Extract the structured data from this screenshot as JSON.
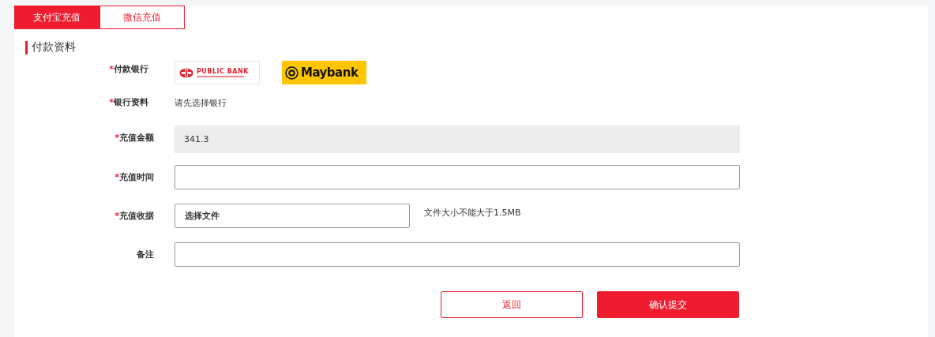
{
  "tabs": [
    {
      "label": "支付宝充值",
      "selected": true
    },
    {
      "label": "微信充值",
      "selected": false
    }
  ],
  "section_title": "付款资料",
  "fields": [
    {
      "kind": "banks",
      "required_mark": "*",
      "label": "付款银行",
      "banks": [
        {
          "kind": "public",
          "name": "PUBLIC BANK"
        },
        {
          "kind": "maybank",
          "name": "Maybank"
        }
      ]
    },
    {
      "kind": "text",
      "required_mark": "*",
      "label": "银行资料",
      "value": "请先选择银行"
    },
    {
      "kind": "readonly",
      "required_mark": "*",
      "label": "充值金额",
      "value": "341.3"
    },
    {
      "kind": "input",
      "required_mark": "*",
      "label": "充值时间"
    },
    {
      "kind": "file",
      "required_mark": "*",
      "label": "充值收据",
      "button": "选择文件",
      "hint": "文件大小不能大于1.5MB"
    },
    {
      "kind": "input",
      "label": "备注"
    }
  ],
  "buttons": [
    {
      "kind": "secondary",
      "label": "返回"
    },
    {
      "kind": "primary",
      "label": "确认提交"
    }
  ]
}
